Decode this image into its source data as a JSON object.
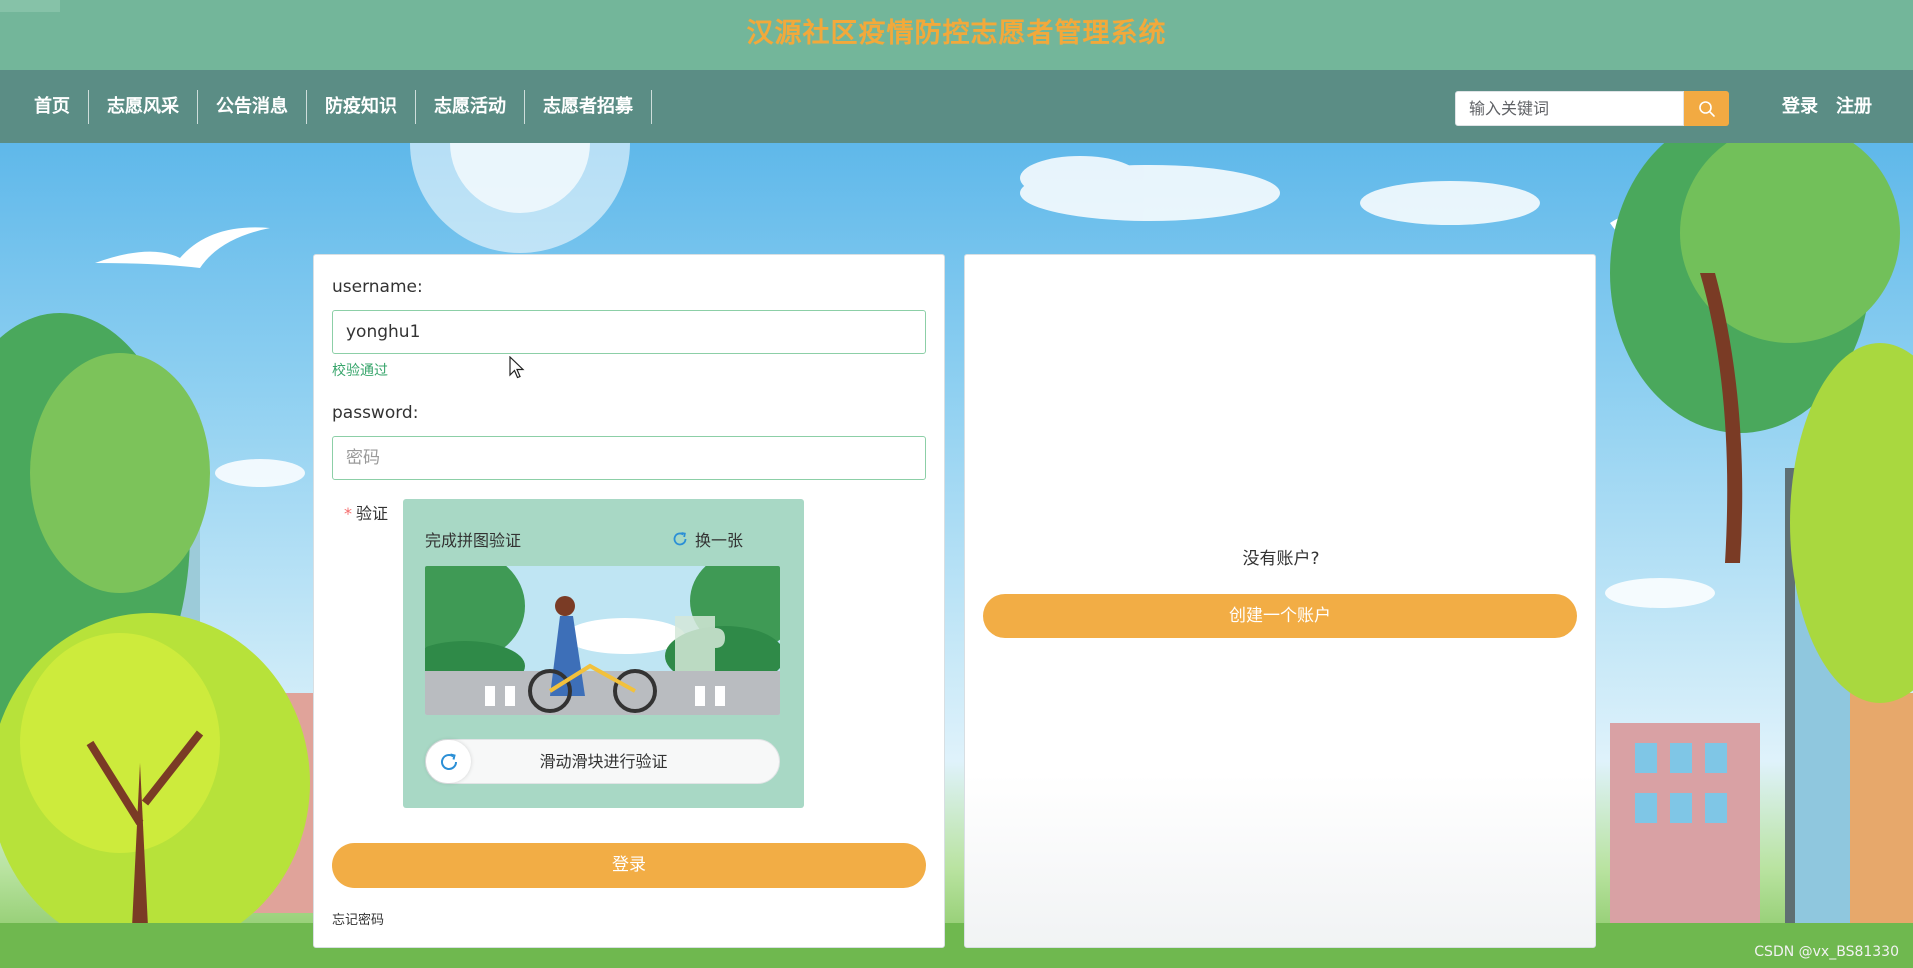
{
  "header": {
    "title": "汉源社区疫情防控志愿者管理系统"
  },
  "nav": {
    "items": [
      "首页",
      "志愿风采",
      "公告消息",
      "防疫知识",
      "志愿活动",
      "志愿者招募"
    ],
    "search_placeholder": "输入关键词",
    "login_label": "登录",
    "register_label": "注册"
  },
  "login_form": {
    "username_label": "username:",
    "username_value": "yonghu1",
    "validation_message": "校验通过",
    "password_label": "password:",
    "password_placeholder": "密码",
    "captcha_label": "验证",
    "captcha_title": "完成拼图验证",
    "captcha_refresh_label": "换一张",
    "slider_text": "滑动滑块进行验证",
    "submit_label": "登录",
    "forgot_label": "忘记密码"
  },
  "register_panel": {
    "prompt": "没有账户?",
    "create_label": "创建一个账户"
  },
  "watermark": "CSDN @vx_BS81330",
  "colors": {
    "header_bg": "#73b69a",
    "nav_bg": "#5b8d85",
    "title_color": "#f2a93b",
    "accent": "#f2ad45",
    "success": "#37a56b"
  },
  "icons": [
    "search-icon",
    "refresh-icon",
    "slider-refresh-icon",
    "mouse-cursor-icon"
  ]
}
